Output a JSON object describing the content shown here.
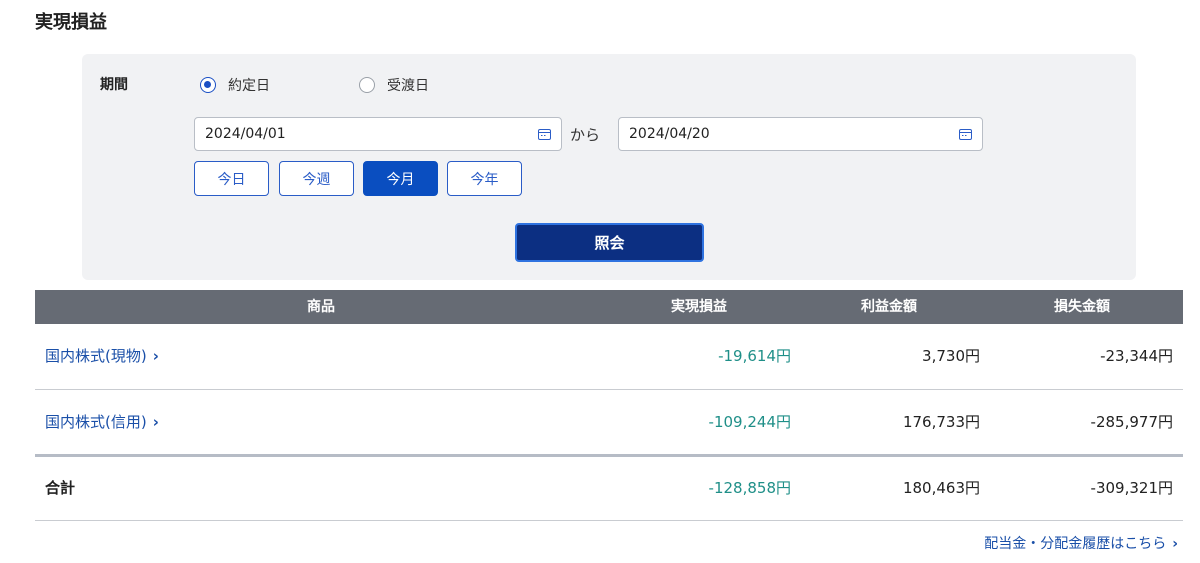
{
  "page": {
    "title": "実現損益"
  },
  "filter": {
    "period_label": "期間",
    "radio_trade_date": "約定日",
    "radio_settle_date": "受渡日",
    "selected": "約定日",
    "date_from": "2024/04/01",
    "kara": "から",
    "date_to": "2024/04/20",
    "quick": {
      "today": "今日",
      "this_week": "今週",
      "this_month": "今月",
      "this_year": "今年"
    },
    "active_quick": "今月",
    "submit_label": "照会"
  },
  "table": {
    "headers": {
      "product": "商品",
      "realized": "実現損益",
      "profit": "利益金額",
      "loss": "損失金額"
    },
    "rows": [
      {
        "product": "国内株式(現物)",
        "realized": "-19,614円",
        "profit": "3,730円",
        "loss": "-23,344円"
      },
      {
        "product": "国内株式(信用)",
        "realized": "-109,244円",
        "profit": "176,733円",
        "loss": "-285,977円"
      }
    ],
    "total": {
      "label": "合計",
      "realized": "-128,858円",
      "profit": "180,463円",
      "loss": "-309,321円"
    }
  },
  "footer": {
    "dividend_link": "配当金・分配金履歴はこちら"
  },
  "icons": {
    "calendar": "calendar-icon",
    "chevron": "chevron-right-icon"
  },
  "colors": {
    "accent": "#0a4ec0",
    "submit": "#0c2f82",
    "header_bg": "#666b74",
    "negative": "#1f8f88"
  }
}
